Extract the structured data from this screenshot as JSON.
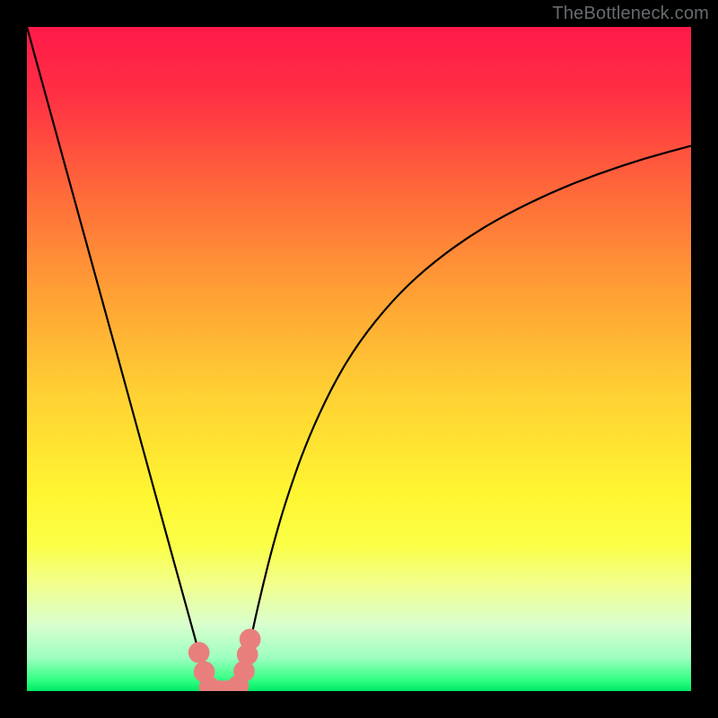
{
  "watermark": "TheBottleneck.com",
  "chart_data": {
    "type": "line",
    "title": "",
    "xlabel": "",
    "ylabel": "",
    "xlim": [
      0,
      100
    ],
    "ylim": [
      0,
      100
    ],
    "background_gradient": {
      "stops": [
        {
          "offset": 0.0,
          "color": "#ff1a49"
        },
        {
          "offset": 0.1,
          "color": "#ff2f44"
        },
        {
          "offset": 0.25,
          "color": "#ff6a3a"
        },
        {
          "offset": 0.4,
          "color": "#ffa035"
        },
        {
          "offset": 0.55,
          "color": "#ffd033"
        },
        {
          "offset": 0.7,
          "color": "#fff531"
        },
        {
          "offset": 0.78,
          "color": "#fbff46"
        },
        {
          "offset": 0.84,
          "color": "#f1ff8e"
        },
        {
          "offset": 0.9,
          "color": "#d9ffce"
        },
        {
          "offset": 0.95,
          "color": "#9dffc0"
        },
        {
          "offset": 0.985,
          "color": "#2cff7f"
        },
        {
          "offset": 1.0,
          "color": "#00e765"
        }
      ]
    },
    "series": [
      {
        "name": "bottleneck-curve",
        "color": "#000000",
        "x": [
          0,
          3,
          6,
          9,
          12,
          15,
          18,
          21,
          23.5,
          25.5,
          27,
          28.3,
          29.2,
          30,
          31,
          32,
          33,
          34,
          35.5,
          37,
          39,
          42,
          46,
          50,
          55,
          60,
          66,
          72,
          79,
          86,
          93,
          100
        ],
        "y": [
          100.0,
          89.1,
          78.2,
          67.3,
          56.4,
          45.5,
          34.5,
          23.6,
          14.5,
          7.3,
          1.8,
          0.0,
          0.0,
          0.0,
          0.0,
          1.1,
          4.0,
          9.3,
          15.8,
          21.8,
          28.7,
          37.3,
          46.0,
          52.6,
          58.8,
          63.6,
          68.1,
          71.7,
          75.1,
          77.9,
          80.2,
          82.1
        ]
      }
    ],
    "markers": {
      "color": "#e97f7d",
      "radius": 1.6,
      "points": [
        {
          "x": 25.9,
          "y": 5.8
        },
        {
          "x": 26.7,
          "y": 2.9
        },
        {
          "x": 27.5,
          "y": 0.6
        },
        {
          "x": 28.3,
          "y": 0.0
        },
        {
          "x": 29.2,
          "y": 0.0
        },
        {
          "x": 30.0,
          "y": 0.0
        },
        {
          "x": 31.0,
          "y": 0.0
        },
        {
          "x": 31.8,
          "y": 0.8
        },
        {
          "x": 32.7,
          "y": 3.0
        },
        {
          "x": 33.2,
          "y": 5.5
        },
        {
          "x": 33.6,
          "y": 7.8
        }
      ]
    }
  }
}
